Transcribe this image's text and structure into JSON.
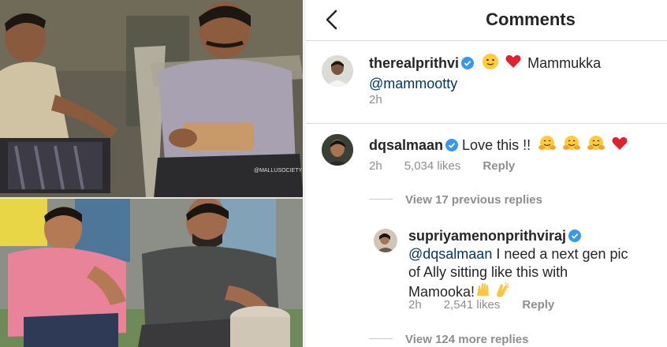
{
  "collage": {
    "watermark": "@MALLUSOCIETY"
  },
  "header": {
    "title": "Comments"
  },
  "post_caption": {
    "username": "therealprithvi",
    "text": "Mammukka",
    "mention": "@mammootty",
    "time": "2h",
    "icons": [
      "slightly-smiling-face-emoji",
      "red-heart-emoji"
    ]
  },
  "comment": {
    "username": "dqsalmaan",
    "text": "Love this !!",
    "time": "2h",
    "likes": "5,034 likes",
    "reply_label": "Reply",
    "icons": [
      "hugging-face-emoji",
      "hugging-face-emoji",
      "hugging-face-emoji",
      "red-heart-emoji"
    ]
  },
  "view_previous_replies": "View 17 previous replies",
  "reply": {
    "username": "supriyamenonprithviraj",
    "mention": "@dqsalmaan",
    "text_line1": "I need a next gen pic",
    "text_line2": "of Ally sitting like this with",
    "text_line3": "Mamooka!",
    "time": "2h",
    "likes": "2,541 likes",
    "reply_label": "Reply",
    "icons": [
      "raising-hands-emoji",
      "clapping-hands-emoji"
    ]
  },
  "view_more_replies": "View 124 more replies",
  "colors": {
    "text": "#262626",
    "secondary": "#8e8e8e",
    "verified": "#3897f0",
    "mention": "#00376b",
    "divider": "#dbdbdb"
  }
}
